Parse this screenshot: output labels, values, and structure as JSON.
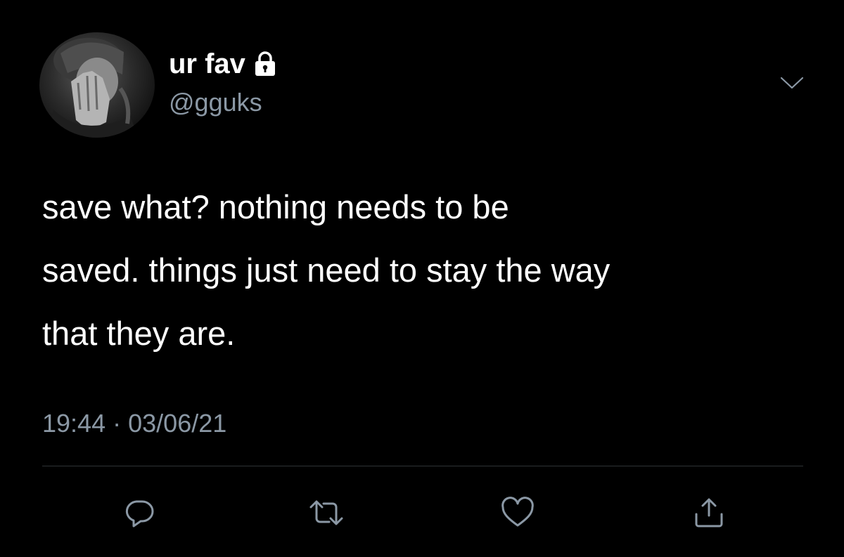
{
  "user": {
    "display_name": "ur fav",
    "handle": "@gguks",
    "protected_icon": "lock-icon",
    "avatar": "profile-photo"
  },
  "tweet": {
    "text": "save what? nothing needs to be saved. things just need to stay the way that they are.",
    "lines": [
      "save what? nothing needs to be",
      "saved. things just need to stay the way",
      "that they are."
    ],
    "time": "19:44",
    "separator": "·",
    "date": "03/06/21"
  },
  "actions": [
    {
      "name": "reply",
      "icon": "reply-icon"
    },
    {
      "name": "retweet",
      "icon": "retweet-icon"
    },
    {
      "name": "like",
      "icon": "heart-icon"
    },
    {
      "name": "share",
      "icon": "share-icon"
    }
  ],
  "colors": {
    "background": "#000000",
    "primary_text": "#ffffff",
    "secondary_text": "#8b98a5",
    "divider": "#2f3336",
    "icon": "#8b98a5"
  }
}
